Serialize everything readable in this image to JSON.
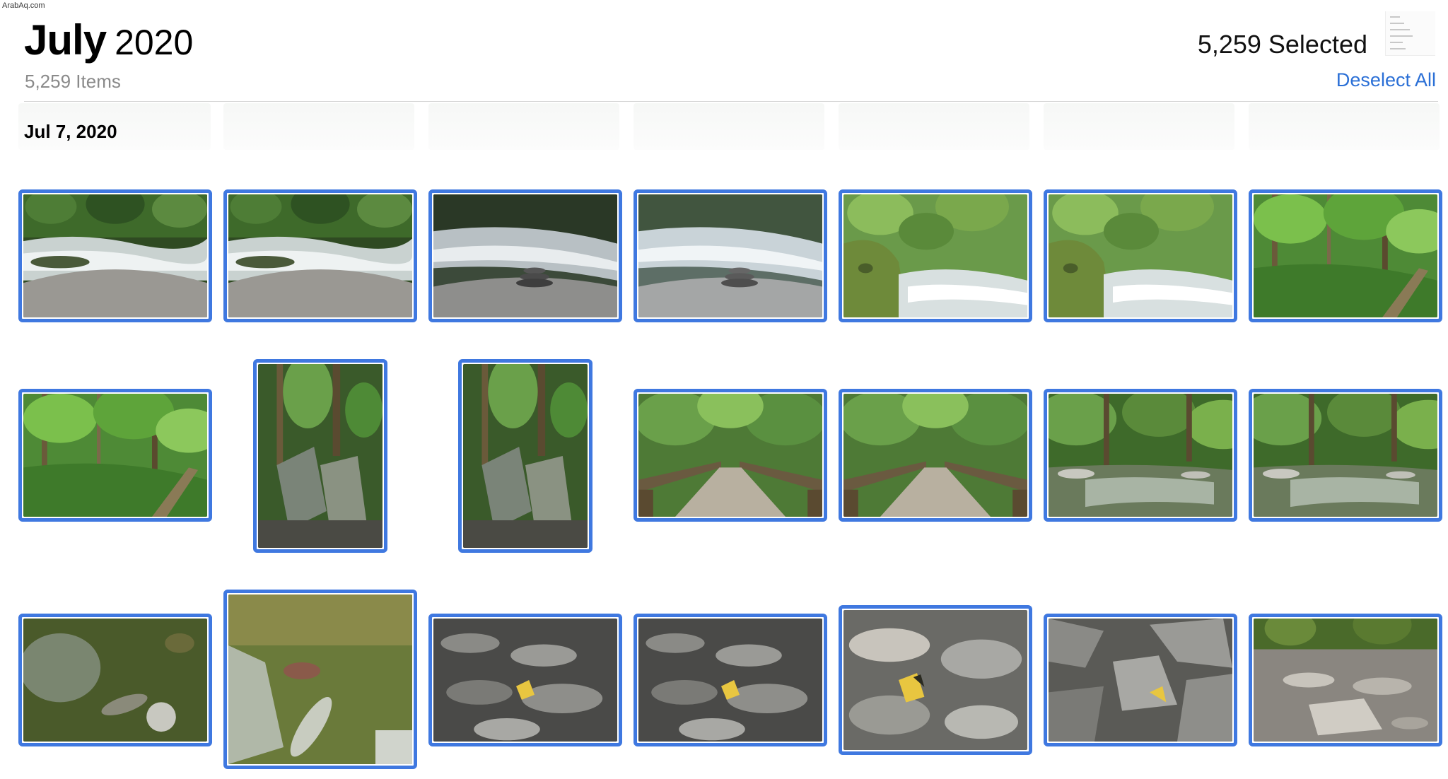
{
  "watermark": "ArabAq.com",
  "header": {
    "month": "July",
    "year": "2020",
    "item_count": "5,259 Items",
    "selected_count": "5,259 Selected",
    "deselect_label": "Deselect All"
  },
  "section": {
    "date": "Jul 7, 2020"
  },
  "colors": {
    "selection": "#3f78e0",
    "accent": "#2a6fd6"
  },
  "photos": [
    {
      "scene": "river-rocks",
      "selected": true
    },
    {
      "scene": "river-rocks",
      "selected": true
    },
    {
      "scene": "cairn-blur",
      "selected": true
    },
    {
      "scene": "cairn-blur-light",
      "selected": true
    },
    {
      "scene": "mossy-cascade",
      "selected": true
    },
    {
      "scene": "mossy-cascade",
      "selected": true
    },
    {
      "scene": "forest-hillside",
      "selected": true
    },
    {
      "scene": "forest-hillside",
      "selected": true
    },
    {
      "scene": "rock-slabs-portrait",
      "selected": true
    },
    {
      "scene": "rock-slabs-portrait",
      "selected": true
    },
    {
      "scene": "wooden-bridge",
      "selected": true
    },
    {
      "scene": "wooden-bridge",
      "selected": true
    },
    {
      "scene": "forest-creek",
      "selected": true
    },
    {
      "scene": "forest-creek",
      "selected": true
    },
    {
      "scene": "clear-water-stones",
      "selected": true
    },
    {
      "scene": "clear-water-closeup",
      "selected": true
    },
    {
      "scene": "stones-butterfly",
      "selected": true
    },
    {
      "scene": "stones-butterfly",
      "selected": true
    },
    {
      "scene": "stones-butterfly-close",
      "selected": true
    },
    {
      "scene": "slate-rocks",
      "selected": true
    },
    {
      "scene": "dry-creek-bed",
      "selected": true
    }
  ]
}
